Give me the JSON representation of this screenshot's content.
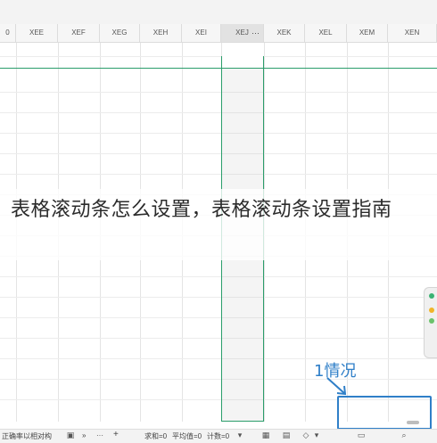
{
  "columns": [
    {
      "label": "0"
    },
    {
      "label": "XEE"
    },
    {
      "label": "XEF"
    },
    {
      "label": "XEG"
    },
    {
      "label": "XEH"
    },
    {
      "label": "XEI"
    },
    {
      "label": "XEJ",
      "selected": true
    },
    {
      "label": "XEK"
    },
    {
      "label": "XEL"
    },
    {
      "label": "XEM"
    },
    {
      "label": "XEN"
    }
  ],
  "more_glyph": "···",
  "overlay_title": "表格滚动条怎么设置，表格滚动条设置指南",
  "annotation": {
    "label": "1情况",
    "color": "#2f7fc8"
  },
  "accent_color": "#2a9d6a",
  "statusbar": {
    "left_text": "正确率以相对构",
    "sum": "求和=0",
    "avg": "平均值=0",
    "count": "计数=0",
    "chevrons": "»",
    "ellipsis": "···",
    "plus": "+"
  },
  "icons": [
    "sheet-icon",
    "chevron-double-right-icon",
    "more-icon",
    "add-sheet-icon",
    "view-normal-icon",
    "view-page-icon",
    "view-layout-icon",
    "paint-icon",
    "zoom-icon"
  ]
}
